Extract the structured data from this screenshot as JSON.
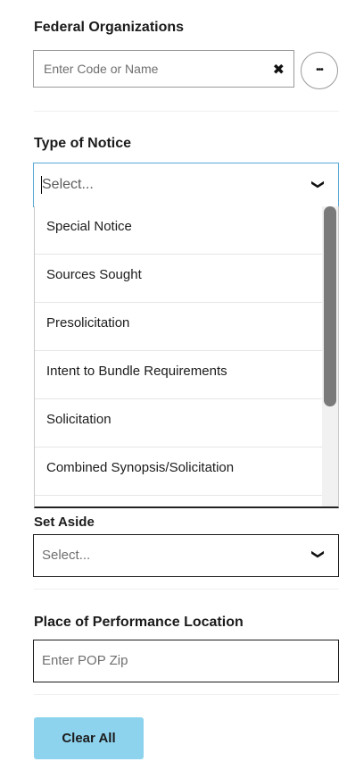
{
  "federal_orgs": {
    "title": "Federal Organizations",
    "placeholder": "Enter Code or Name",
    "clear_icon": "✖",
    "more_icon": "•••"
  },
  "type_of_notice": {
    "title": "Type of Notice",
    "selected": "Select...",
    "chevron": "❯",
    "options": [
      "Special Notice",
      "Sources Sought",
      "Presolicitation",
      "Intent to Bundle Requirements",
      "Solicitation",
      "Combined Synopsis/Solicitation"
    ]
  },
  "set_aside": {
    "title": "Set Aside",
    "selected": "Select..."
  },
  "place_of_performance": {
    "title": "Place of Performance Location",
    "placeholder": "Enter POP Zip"
  },
  "clear_all_label": "Clear All",
  "colors": {
    "button_bg": "#8dd3ee",
    "focus_border": "#5aa8d6"
  }
}
